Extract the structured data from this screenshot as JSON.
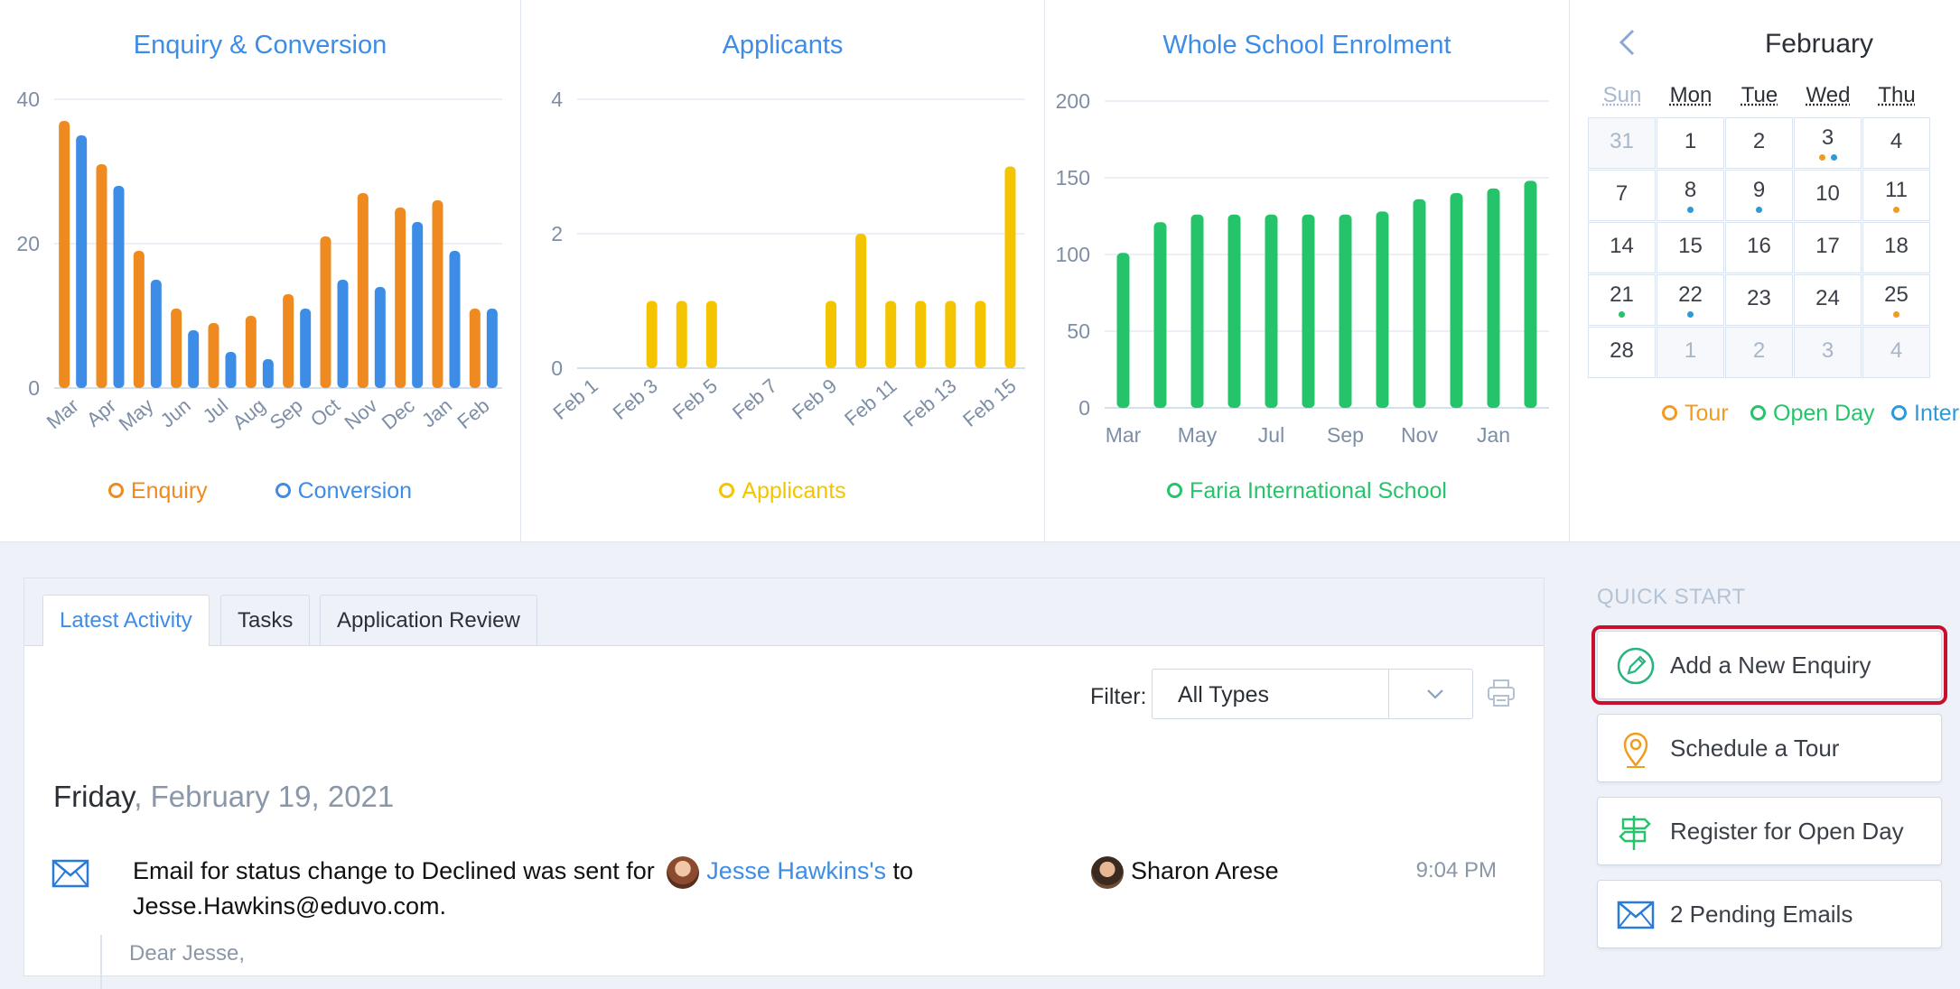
{
  "charts": {
    "enquiry": {
      "title": "Enquiry & Conversion",
      "legend": [
        {
          "label": "Enquiry",
          "color": "#ef8a21"
        },
        {
          "label": "Conversion",
          "color": "#3d8de6"
        }
      ]
    },
    "applicants": {
      "title": "Applicants",
      "legend": [
        {
          "label": "Applicants",
          "color": "#f5c400"
        }
      ]
    },
    "enrolment": {
      "title": "Whole School Enrolment",
      "legend": [
        {
          "label": "Faria International School",
          "color": "#26c46a"
        }
      ]
    }
  },
  "chart_data": [
    {
      "type": "bar",
      "title": "Enquiry & Conversion",
      "categories": [
        "Mar",
        "Apr",
        "May",
        "Jun",
        "Jul",
        "Aug",
        "Sep",
        "Oct",
        "Nov",
        "Dec",
        "Jan",
        "Feb"
      ],
      "series": [
        {
          "name": "Enquiry",
          "values": [
            37,
            31,
            19,
            11,
            9,
            10,
            13,
            21,
            27,
            25,
            26,
            11
          ]
        },
        {
          "name": "Conversion",
          "values": [
            35,
            28,
            15,
            8,
            5,
            4,
            11,
            15,
            14,
            23,
            19,
            11
          ]
        }
      ],
      "yticks": [
        0,
        20,
        40
      ],
      "ylim": [
        0,
        40
      ]
    },
    {
      "type": "bar",
      "title": "Applicants",
      "categories": [
        "Feb 1",
        "Feb 2",
        "Feb 3",
        "Feb 4",
        "Feb 5",
        "Feb 6",
        "Feb 7",
        "Feb 8",
        "Feb 9",
        "Feb 10",
        "Feb 11",
        "Feb 12",
        "Feb 13",
        "Feb 14",
        "Feb 15"
      ],
      "tick_labels": [
        "Feb 1",
        "Feb 3",
        "Feb 5",
        "Feb 7",
        "Feb 9",
        "Feb 11",
        "Feb 13",
        "Feb 15"
      ],
      "series": [
        {
          "name": "Applicants",
          "values": [
            0,
            0,
            1,
            1,
            1,
            0,
            0,
            0,
            1,
            2,
            1,
            1,
            1,
            1,
            3
          ]
        }
      ],
      "yticks": [
        0,
        2,
        4
      ],
      "ylim": [
        0,
        4
      ]
    },
    {
      "type": "bar",
      "title": "Whole School Enrolment",
      "categories": [
        "Mar",
        "Apr",
        "May",
        "Jun",
        "Jul",
        "Aug",
        "Sep",
        "Oct",
        "Nov",
        "Dec",
        "Jan",
        "Feb"
      ],
      "tick_labels": [
        "Mar",
        "May",
        "Jul",
        "Sep",
        "Nov",
        "Jan"
      ],
      "series": [
        {
          "name": "Faria International School",
          "values": [
            101,
            121,
            126,
            126,
            126,
            126,
            126,
            128,
            136,
            140,
            143,
            148
          ]
        }
      ],
      "yticks": [
        0,
        50,
        100,
        150,
        200
      ],
      "ylim": [
        0,
        200
      ]
    }
  ],
  "calendar": {
    "month": "February",
    "days_of_week": [
      "Sun",
      "Mon",
      "Tue",
      "Wed",
      "Thu"
    ],
    "weeks": [
      [
        {
          "d": "31",
          "muted": true
        },
        {
          "d": "1"
        },
        {
          "d": "2"
        },
        {
          "d": "3",
          "dots": [
            "tour",
            "interview"
          ]
        },
        {
          "d": "4"
        }
      ],
      [
        {
          "d": "7"
        },
        {
          "d": "8",
          "dots": [
            "interview"
          ]
        },
        {
          "d": "9",
          "dots": [
            "interview"
          ]
        },
        {
          "d": "10"
        },
        {
          "d": "11",
          "dots": [
            "tour"
          ]
        }
      ],
      [
        {
          "d": "14"
        },
        {
          "d": "15"
        },
        {
          "d": "16"
        },
        {
          "d": "17"
        },
        {
          "d": "18"
        }
      ],
      [
        {
          "d": "21",
          "dots": [
            "openday"
          ]
        },
        {
          "d": "22",
          "dots": [
            "interview"
          ]
        },
        {
          "d": "23"
        },
        {
          "d": "24"
        },
        {
          "d": "25",
          "dots": [
            "tour"
          ]
        }
      ],
      [
        {
          "d": "28"
        },
        {
          "d": "1",
          "muted": true
        },
        {
          "d": "2",
          "muted": true
        },
        {
          "d": "3",
          "muted": true
        },
        {
          "d": "4",
          "muted": true
        }
      ]
    ],
    "legend": [
      {
        "label": "Tour",
        "key": "tour",
        "color": "#f29c1f"
      },
      {
        "label": "Open Day",
        "key": "openday",
        "color": "#26c46a"
      },
      {
        "label": "Inter",
        "key": "interview",
        "color": "#2a9bd8"
      }
    ]
  },
  "tabs": [
    {
      "label": "Latest Activity",
      "active": true
    },
    {
      "label": "Tasks",
      "active": false
    },
    {
      "label": "Application Review",
      "active": false
    }
  ],
  "filter": {
    "label": "Filter:",
    "value": "All Types"
  },
  "activity": {
    "day": "Friday",
    "date": ", February 19, 2021",
    "entry": {
      "text_before": "Email for status change to Declined was sent for ",
      "link": "Jesse Hawkins's",
      "text_after": " to",
      "email": "Jesse.Hawkins@eduvo.com.",
      "user": "Sharon Arese",
      "time": "9:04 PM",
      "preview": "Dear Jesse,"
    }
  },
  "quick_start": {
    "title": "QUICK START",
    "buttons": [
      {
        "label": "Add a New Enquiry",
        "icon": "pencil-circle-icon",
        "color": "#26b57c"
      },
      {
        "label": "Schedule a Tour",
        "icon": "map-pin-icon",
        "color": "#f29c1f"
      },
      {
        "label": "Register for Open Day",
        "icon": "signpost-icon",
        "color": "#26c46a"
      },
      {
        "label": "2 Pending Emails",
        "icon": "envelope-icon",
        "color": "#2a7bd8"
      }
    ]
  }
}
